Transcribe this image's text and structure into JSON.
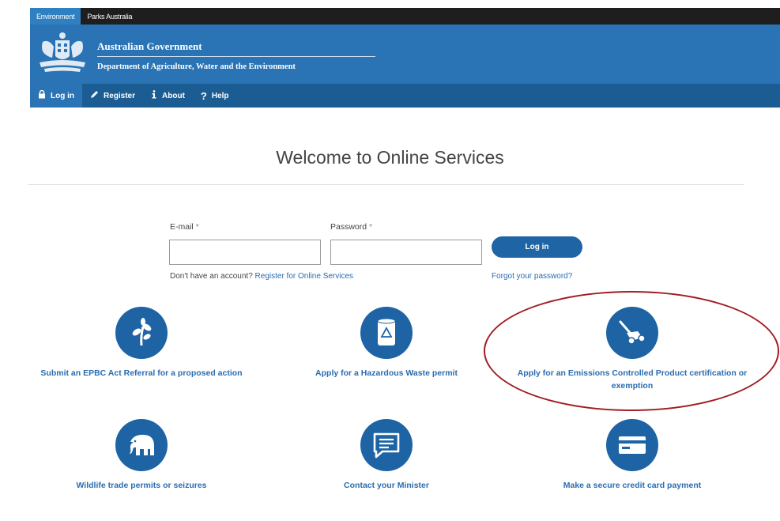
{
  "topbar": {
    "tabs": [
      "Environment",
      "Parks Australia"
    ]
  },
  "header": {
    "title": "Australian Government",
    "department": "Department of Agriculture, Water and the Environment"
  },
  "nav": {
    "items": [
      {
        "label": "Log in",
        "icon": "lock-icon"
      },
      {
        "label": "Register",
        "icon": "pencil-icon"
      },
      {
        "label": "About",
        "icon": "info-icon"
      },
      {
        "label": "Help",
        "icon": "question-icon"
      }
    ]
  },
  "welcome": "Welcome to Online Services",
  "login": {
    "email_label": "E-mail",
    "password_label": "Password",
    "required_mark": "*",
    "email_value": "",
    "password_value": "",
    "button": "Log in",
    "no_account": "Don't have an account?",
    "register_link": "Register for Online Services",
    "forgot": "Forgot your password?"
  },
  "services": [
    {
      "label": "Submit an EPBC Act Referral for a proposed action",
      "icon": "plant-sprout-icon"
    },
    {
      "label": "Apply for a Hazardous Waste permit",
      "icon": "hazard-drum-icon"
    },
    {
      "label": "Apply for an Emissions Controlled Product certification or exemption",
      "icon": "lawn-mower-icon"
    },
    {
      "label": "Wildlife trade permits or seizures",
      "icon": "elephant-icon"
    },
    {
      "label": "Contact your Minister",
      "icon": "speech-bubble-icon"
    },
    {
      "label": "Make a secure credit card payment",
      "icon": "credit-card-icon"
    }
  ],
  "colors": {
    "header_blue": "#2a74b5",
    "nav_blue": "#1b5d92",
    "icon_blue": "#1e63a3",
    "link_blue": "#2a6cb0",
    "highlight_red": "#a01c22"
  }
}
